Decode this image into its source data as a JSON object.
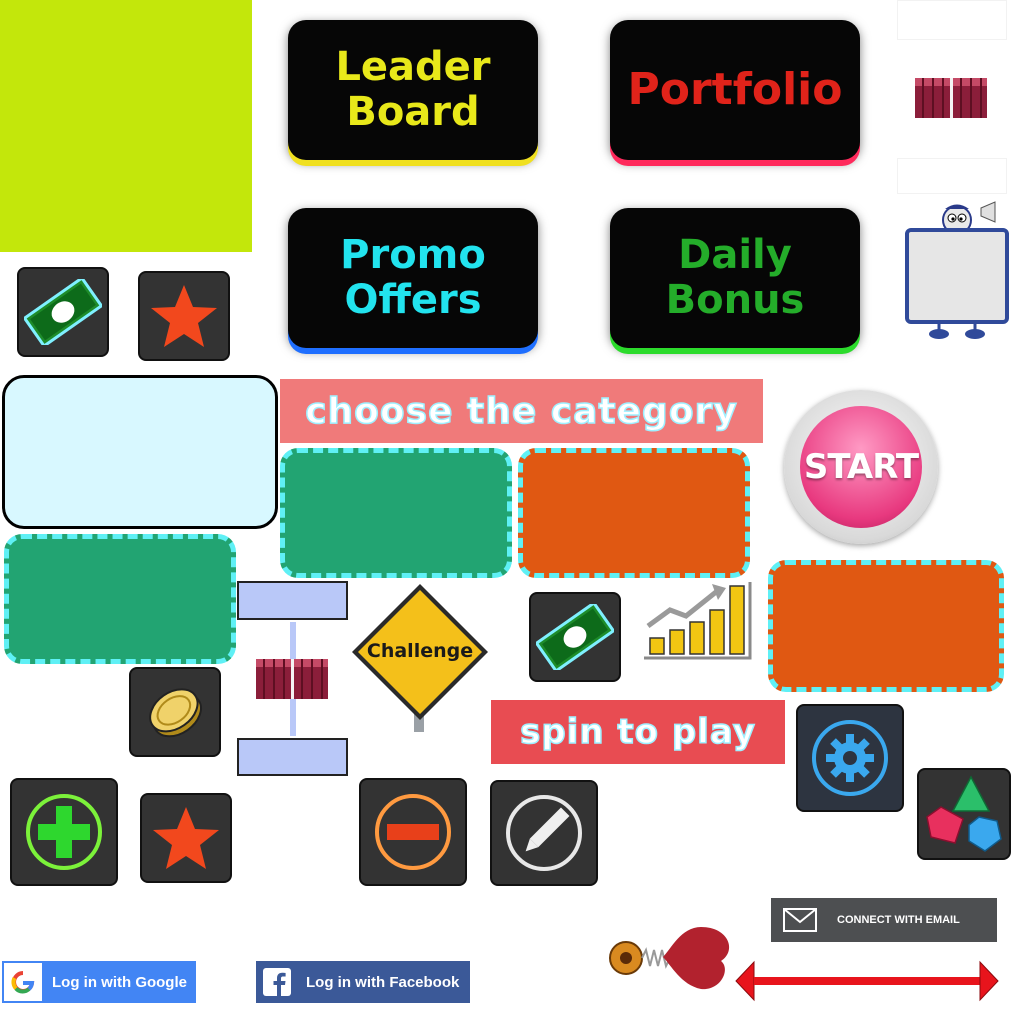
{
  "menu": {
    "leader_board": {
      "line1": "Leader",
      "line2": "Board"
    },
    "portfolio": "Portfolio",
    "promo_offers": {
      "line1": "Promo",
      "line2": "Offers"
    },
    "daily_bonus": {
      "line1": "Daily",
      "line2": "Bonus"
    }
  },
  "banners": {
    "choose_category": "choose the category",
    "spin_to_play": "spin to play"
  },
  "start_button": "START",
  "challenge_sign": "Challenge",
  "login": {
    "google": "Log in with Google",
    "facebook": "Log in with Facebook",
    "email": "CONNECT WITH EMAIL"
  },
  "colors": {
    "lime_panel": "#c3e70b",
    "category_green": "#22a472",
    "category_orange": "#e05812",
    "banner_bg": "#f07a7a",
    "google_blue": "#4285f4",
    "facebook_blue": "#3b5998"
  },
  "icons": [
    "money-icon",
    "star-icon",
    "coin-icon",
    "plus-icon",
    "minus-icon",
    "pencil-icon",
    "gear-icon",
    "gems-icon",
    "growth-chart-icon",
    "mascot-icon",
    "heart-spring-icon",
    "email-icon",
    "google-icon",
    "facebook-icon"
  ]
}
